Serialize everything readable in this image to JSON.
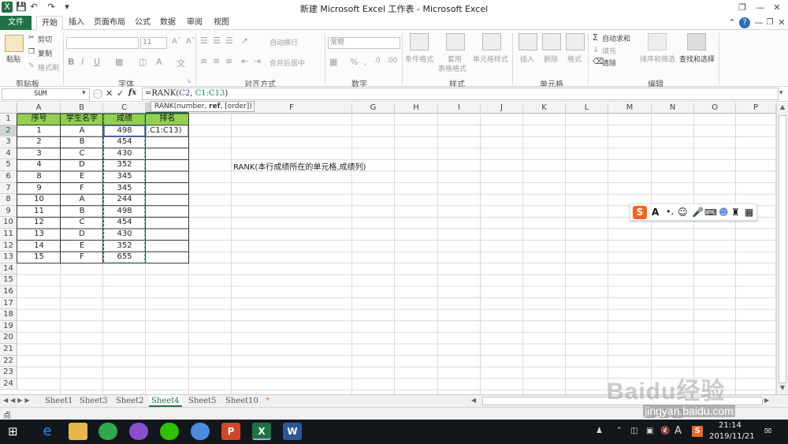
{
  "window": {
    "title": "新建 Microsoft Excel 工作表 - Microsoft Excel"
  },
  "tabs": [
    "文件",
    "开始",
    "插入",
    "页面布局",
    "公式",
    "数据",
    "审阅",
    "视图"
  ],
  "ribbon": {
    "clipboard": {
      "label": "剪贴板",
      "paste": "粘贴",
      "cut": "剪切",
      "copy": "复制",
      "format_painter": "格式刷"
    },
    "font": {
      "label": "字体",
      "size": "11",
      "bold": "B",
      "italic": "I",
      "underline": "U"
    },
    "alignment": {
      "label": "对齐方式",
      "wrap": "自动换行",
      "merge": "合并后居中"
    },
    "number": {
      "label": "数字",
      "format": "常规"
    },
    "styles": {
      "label": "样式",
      "conditional": "条件格式",
      "table": "套用",
      "table2": "表格格式",
      "cell_styles": "单元格样式"
    },
    "cells": {
      "label": "单元格",
      "insert": "插入",
      "delete": "删除",
      "format": "格式"
    },
    "editing": {
      "label": "编辑",
      "autosum": "自动求和",
      "fill": "填充",
      "clear": "清除",
      "sort": "排序和筛选",
      "find": "查找和选择"
    }
  },
  "formula_bar": {
    "name_box": "SUM",
    "formula_prefix": "=RANK(",
    "ref1": "C2",
    "sep": ", ",
    "ref2": "C1:C13",
    "formula_suffix": ")",
    "fx": "fx"
  },
  "tooltip": {
    "prefix": "RANK(number, ",
    "bold": "ref",
    "suffix": ", [order])"
  },
  "columns": [
    "A",
    "B",
    "C",
    "D",
    "E",
    "F",
    "G",
    "H",
    "I",
    "J",
    "K",
    "L",
    "M",
    "N",
    "O",
    "P"
  ],
  "rows": [
    "1",
    "2",
    "3",
    "4",
    "5",
    "6",
    "7",
    "8",
    "9",
    "10",
    "11",
    "12",
    "13",
    "14",
    "15",
    "16",
    "17",
    "18",
    "19",
    "20",
    "21",
    "22",
    "23",
    "24"
  ],
  "headers": {
    "a": "序号",
    "b": "学生名字",
    "c": "成绩",
    "d": "排名"
  },
  "table": [
    [
      "1",
      "A",
      "498",
      ".C1:C13)"
    ],
    [
      "2",
      "B",
      "454",
      ""
    ],
    [
      "3",
      "C",
      "430",
      ""
    ],
    [
      "4",
      "D",
      "352",
      ""
    ],
    [
      "8",
      "E",
      "345",
      ""
    ],
    [
      "9",
      "F",
      "345",
      ""
    ],
    [
      "10",
      "A",
      "244",
      ""
    ],
    [
      "11",
      "B",
      "498",
      ""
    ],
    [
      "12",
      "C",
      "454",
      ""
    ],
    [
      "13",
      "D",
      "430",
      ""
    ],
    [
      "14",
      "E",
      "352",
      ""
    ],
    [
      "15",
      "F",
      "655",
      ""
    ]
  ],
  "note": "RANK(本行成绩所在的单元格,成绩列)",
  "sheets": [
    "Sheet1",
    "Sheet3",
    "Sheet2",
    "Sheet4",
    "Sheet5",
    "Sheet10"
  ],
  "active_sheet_index": 3,
  "status": {
    "mode": "点"
  },
  "taskbar": {
    "time": "21:14",
    "date": "2019/11/21",
    "ime": "A"
  },
  "watermark": {
    "brand": "Baidu经验",
    "url": "jingyan.baidu.com"
  },
  "colors": {
    "excel_green": "#1f7244",
    "header_fill": "#92d050",
    "accent_blue": "#2c4ea0"
  }
}
